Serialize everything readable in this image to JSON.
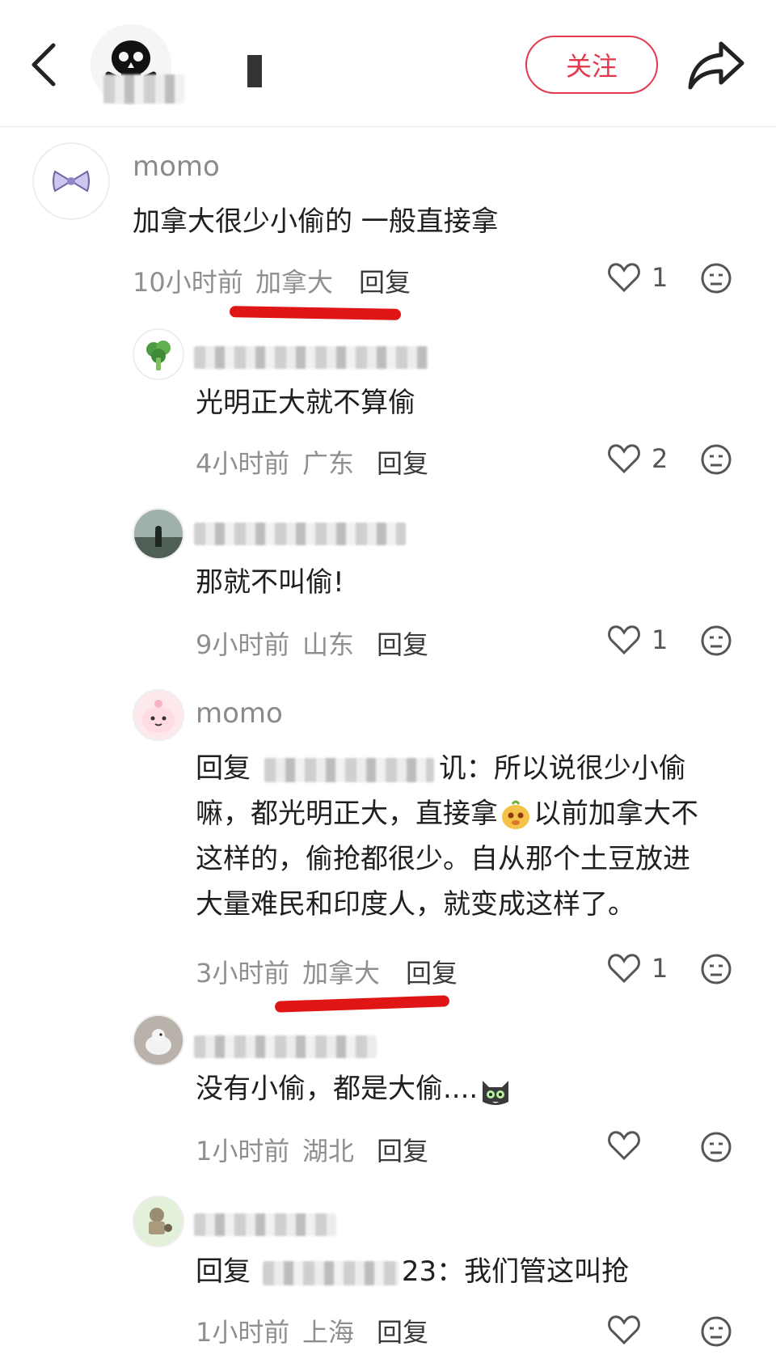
{
  "header": {
    "follow_label": "关注"
  },
  "comments": [
    {
      "username": "momo",
      "text": "加拿大很少小偷的 一般直接拿",
      "time": "10小时前",
      "location": "加拿大",
      "reply_label": "回复",
      "likes": "1"
    },
    {
      "username": "",
      "text": "光明正大就不算偷",
      "time": "4小时前",
      "location": "广东",
      "reply_label": "回复",
      "likes": "2"
    },
    {
      "username": "",
      "text": "那就不叫偷!",
      "time": "9小时前",
      "location": "山东",
      "reply_label": "回复",
      "likes": "1"
    },
    {
      "username": "momo",
      "reply_prefix": "回复",
      "mention_suffix": "讥：",
      "line1": "所以说很少小偷",
      "line2a": "嘛，都光明正大，直接拿",
      "line2b": "以前加拿大不",
      "line3": "这样的，偷抢都很少。自从那个土豆放进",
      "line4": "大量难民和印度人，就变成这样了。",
      "time": "3小时前",
      "location": "加拿大",
      "reply_label": "回复",
      "likes": "1"
    },
    {
      "username": "",
      "text": "没有小偷，都是大偷....",
      "time": "1小时前",
      "location": "湖北",
      "reply_label": "回复",
      "likes": ""
    },
    {
      "username": "",
      "reply_prefix": "回复",
      "mention_suffix": "23：",
      "text": "我们管这叫抢",
      "time": "1小时前",
      "location": "上海",
      "reply_label": "回复"
    }
  ]
}
